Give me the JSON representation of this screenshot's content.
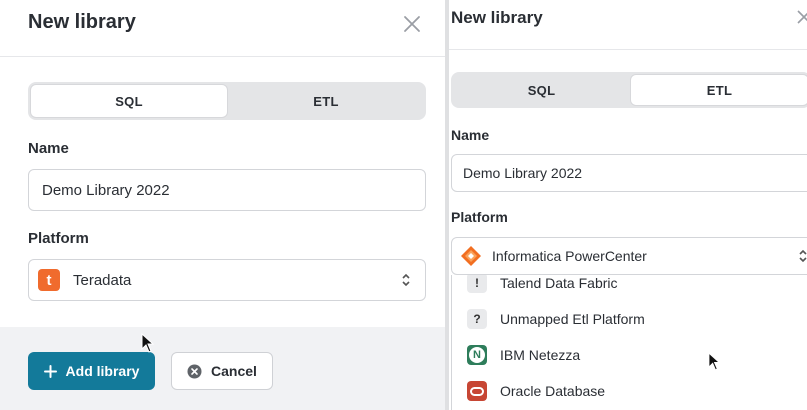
{
  "left_panel": {
    "title": "New library",
    "tabs": [
      {
        "label": "SQL",
        "active": true
      },
      {
        "label": "ETL",
        "active": false
      }
    ],
    "name_label": "Name",
    "name_value": "Demo Library 2022",
    "platform_label": "Platform",
    "platform_value": "Teradata",
    "platform_icon": "teradata-logo",
    "platform_icon_letter": "t",
    "add_button": "Add library",
    "cancel_button": "Cancel"
  },
  "right_panel": {
    "title": "New library",
    "tabs": [
      {
        "label": "SQL",
        "active": false
      },
      {
        "label": "ETL",
        "active": true
      }
    ],
    "name_label": "Name",
    "name_value": "Demo Library 2022",
    "platform_label": "Platform",
    "platform_value": "Informatica PowerCenter",
    "platform_icon": "informatica-logo",
    "dropdown_items": [
      {
        "label": "Talend Data Fabric",
        "icon": "unknown-platform-icon",
        "glyph": "!"
      },
      {
        "label": "Unmapped Etl Platform",
        "icon": "question-icon",
        "glyph": "?"
      },
      {
        "label": "IBM Netezza",
        "icon": "netezza-logo",
        "glyph": "N"
      },
      {
        "label": "Oracle Database",
        "icon": "oracle-logo",
        "glyph": ""
      }
    ]
  },
  "colors": {
    "primary": "#137a9a",
    "teradata": "#f06b2d",
    "informatica": "#f26f21",
    "netezza": "#2e7d5b",
    "oracle": "#c74634",
    "footer_bg": "#f1f2f4",
    "segment_bg": "#e4e5e7"
  }
}
